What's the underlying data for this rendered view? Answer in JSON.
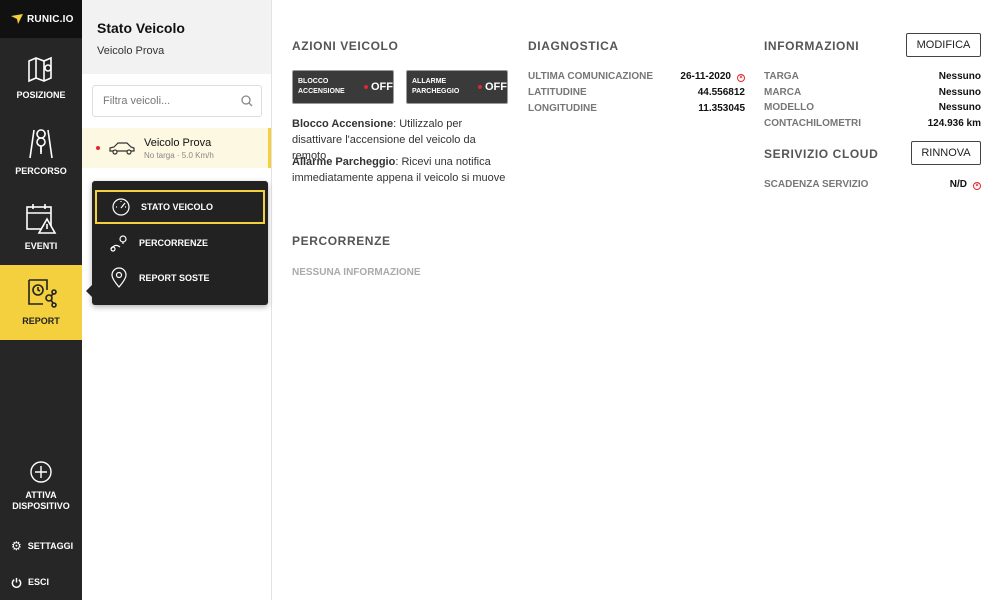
{
  "logo": {
    "text": "RUNIC.IO"
  },
  "nav": {
    "posizione": "POSIZIONE",
    "percorso": "PERCORSO",
    "eventi": "EVENTI",
    "report": "REPORT",
    "attiva_line1": "ATTIVA",
    "attiva_line2": "DISPOSITIVO",
    "settaggi": "SETTAGGI",
    "esci": "ESCI"
  },
  "panel": {
    "title": "Stato Veicolo",
    "subtitle": "Veicolo Prova",
    "search_placeholder": "Filtra veicoli...",
    "vehicle": {
      "name": "Veicolo Prova",
      "meta": "No targa · 5.0 Km/h"
    }
  },
  "menu": {
    "items": [
      "STATO VEICOLO",
      "PERCORRENZE",
      "REPORT SOSTE"
    ]
  },
  "azioni": {
    "title": "AZIONI VEICOLO",
    "blocco_l1": "BLOCCO",
    "blocco_l2": "ACCENSIONE",
    "blocco_state": "OFF",
    "allarme_l1": "ALLARME",
    "allarme_l2": "PARCHEGGIO",
    "allarme_state": "OFF",
    "desc1_bold": "Blocco Accensione",
    "desc1_text": ": Utilizzalo per disattivare l'accensione del veicolo da remoto",
    "desc2_bold": "Allarme Parcheggio",
    "desc2_text": ": Ricevi una notifica immediatamente appena il veicolo si muove"
  },
  "percorrenze": {
    "title": "PERCORRENZE",
    "empty": "NESSUNA INFORMAZIONE"
  },
  "diagnostica": {
    "title": "DIAGNOSTICA",
    "rows": [
      {
        "k": "ULTIMA COMUNICAZIONE",
        "v": "26-11-2020"
      },
      {
        "k": "LATITUDINE",
        "v": "44.556812"
      },
      {
        "k": "LONGITUDINE",
        "v": "11.353045"
      }
    ]
  },
  "informazioni": {
    "title": "INFORMAZIONI",
    "edit_label": "MODIFICA",
    "rows": [
      {
        "k": "TARGA",
        "v": "Nessuno"
      },
      {
        "k": "MARCA",
        "v": "Nessuno"
      },
      {
        "k": "MODELLO",
        "v": "Nessuno"
      },
      {
        "k": "CONTACHILOMETRI",
        "v": "124.936 km"
      }
    ]
  },
  "cloud": {
    "title": "SERIVIZIO CLOUD",
    "renew_label": "RINNOVA",
    "k": "SCADENZA SERVIZIO",
    "v": "N/D"
  },
  "colors": {
    "accent": "#f4d03f",
    "sidebar": "#262626",
    "alert": "#e0282e"
  }
}
